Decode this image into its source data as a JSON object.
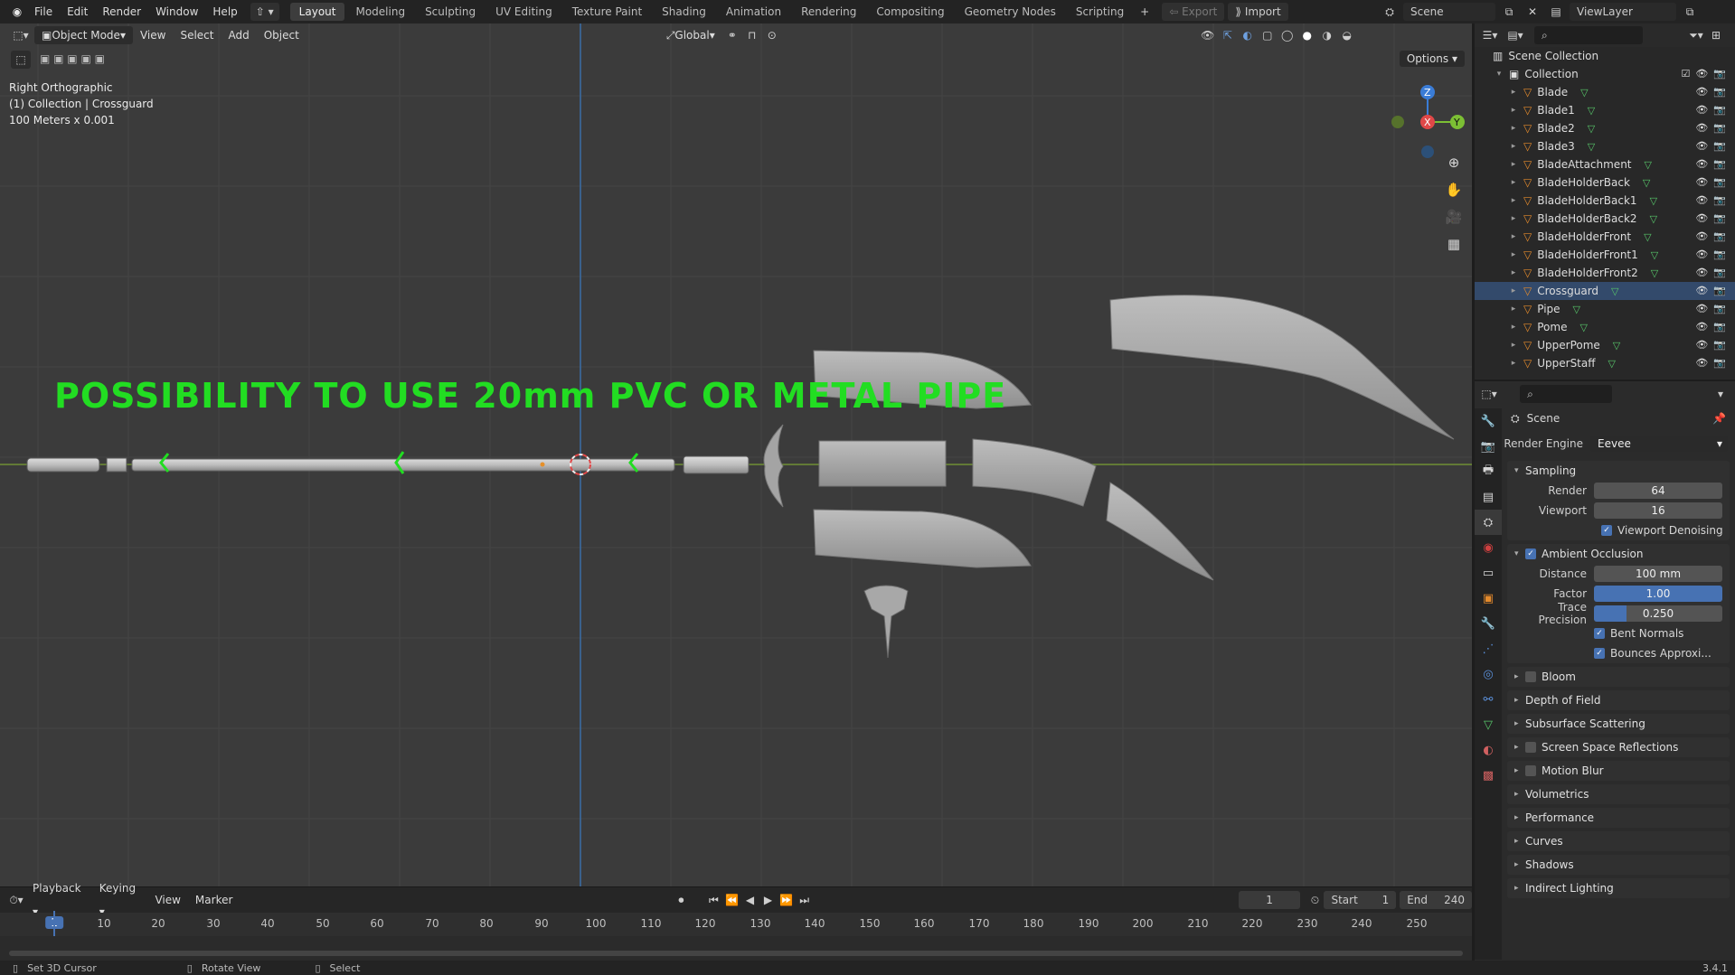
{
  "topbar": {
    "menus": [
      "File",
      "Edit",
      "Render",
      "Window",
      "Help"
    ],
    "workspaces": [
      "Layout",
      "Modeling",
      "Sculpting",
      "UV Editing",
      "Texture Paint",
      "Shading",
      "Animation",
      "Rendering",
      "Compositing",
      "Geometry Nodes",
      "Scripting"
    ],
    "active_workspace": "Layout",
    "export_label": "Export",
    "import_label": "Import",
    "scene_name": "Scene",
    "view_layer": "ViewLayer"
  },
  "viewport": {
    "mode": "Object Mode",
    "menus": [
      "View",
      "Select",
      "Add",
      "Object"
    ],
    "orientation": "Global",
    "options_label": "Options",
    "info": {
      "view": "Right Orthographic",
      "collection": "(1) Collection | Crossguard",
      "scale": "100 Meters x 0.001"
    },
    "overlay_text": "POSSIBILITY TO USE 20mm PVC OR METAL PIPE",
    "gizmo": {
      "z": "Z",
      "x": "X",
      "y": "Y"
    },
    "colors": {
      "overlay_text": "#22dd22",
      "background": "#3b3b3b",
      "z_axis": "#3a7cd6",
      "x_axis": "#e04848",
      "y_axis": "#7cbf34"
    }
  },
  "outliner": {
    "root": "Scene Collection",
    "collection": "Collection",
    "objects": [
      "Blade",
      "Blade1",
      "Blade2",
      "Blade3",
      "BladeAttachment",
      "BladeHolderBack",
      "BladeHolderBack1",
      "BladeHolderBack2",
      "BladeHolderFront",
      "BladeHolderFront1",
      "BladeHolderFront2",
      "Crossguard",
      "Pipe",
      "Pome",
      "UpperPome",
      "UpperStaff"
    ],
    "selected": "Crossguard"
  },
  "properties": {
    "title": "Scene",
    "render_engine_label": "Render Engine",
    "render_engine": "Eevee",
    "sampling": {
      "title": "Sampling",
      "render_label": "Render",
      "render": "64",
      "viewport_label": "Viewport",
      "viewport": "16",
      "denoise_label": "Viewport Denoising"
    },
    "ao": {
      "title": "Ambient Occlusion",
      "distance_label": "Distance",
      "distance": "100 mm",
      "factor_label": "Factor",
      "factor": "1.00",
      "trace_label": "Trace Precision",
      "trace": "0.250",
      "bent_label": "Bent Normals",
      "bounces_label": "Bounces Approxi..."
    },
    "panels": [
      "Bloom",
      "Depth of Field",
      "Subsurface Scattering",
      "Screen Space Reflections",
      "Motion Blur",
      "Volumetrics",
      "Performance",
      "Curves",
      "Shadows",
      "Indirect Lighting"
    ],
    "checkbox_panels": [
      "Bloom",
      "Screen Space Reflections",
      "Motion Blur"
    ]
  },
  "timeline": {
    "menus": [
      "Playback",
      "Keying",
      "View",
      "Marker"
    ],
    "current_frame": "1",
    "start_label": "Start",
    "start": "1",
    "end_label": "End",
    "end": "240",
    "ticks": [
      "10",
      "20",
      "30",
      "40",
      "50",
      "60",
      "70",
      "80",
      "90",
      "100",
      "110",
      "120",
      "130",
      "140",
      "150",
      "160",
      "170",
      "180",
      "190",
      "200",
      "210",
      "220",
      "230",
      "240",
      "250"
    ]
  },
  "statusbar": {
    "items": [
      "Set 3D Cursor",
      "Rotate View",
      "Select"
    ],
    "version": "3.4.1"
  }
}
